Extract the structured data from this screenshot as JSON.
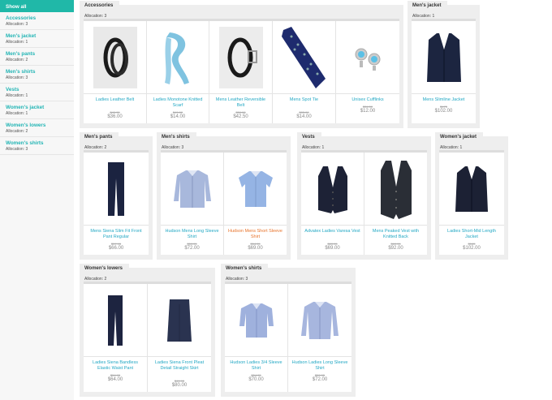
{
  "sidebar": {
    "items": [
      {
        "title": "Show all",
        "sub": ""
      },
      {
        "title": "Accessories",
        "sub": "Allocation: 3"
      },
      {
        "title": "Men's jacket",
        "sub": "Allocation: 1"
      },
      {
        "title": "Men's pants",
        "sub": "Allocation: 2"
      },
      {
        "title": "Men's shirts",
        "sub": "Allocation: 3"
      },
      {
        "title": "Vests",
        "sub": "Allocation: 1"
      },
      {
        "title": "Women's jacket",
        "sub": "Allocation: 1"
      },
      {
        "title": "Women's lowers",
        "sub": "Allocation: 2"
      },
      {
        "title": "Women's shirts",
        "sub": "Allocation: 3"
      }
    ]
  },
  "categories": [
    {
      "name": "Accessories",
      "alloc": "Allocation: 3",
      "items": [
        {
          "name": "Ladies Leather Belt",
          "old": "$49.95",
          "price": "$36.00"
        },
        {
          "name": "Ladies Monotone Knitted Scarf",
          "old": "$49.00",
          "price": "$14.00"
        },
        {
          "name": "Mens Leather Reversible Belt",
          "old": "$59.00",
          "price": "$42.50"
        },
        {
          "name": "Mens Spot Tie",
          "old": "$35.00",
          "price": "$14.00"
        },
        {
          "name": "Unisex Cufflinks",
          "old": "$34.00",
          "price": "$12.00"
        }
      ]
    },
    {
      "name": "Men's jacket",
      "alloc": "Allocation: 1",
      "items": [
        {
          "name": "Mens Slimline Jacket",
          "old": "$175",
          "price": "$102.00"
        }
      ]
    },
    {
      "name": "Men's pants",
      "alloc": "Allocation: 2",
      "items": [
        {
          "name": "Mens Siena Slim Fit Front Pant Regular",
          "old": "$57.95",
          "price": "$66.00"
        }
      ]
    },
    {
      "name": "Men's shirts",
      "alloc": "Allocation: 3",
      "items": [
        {
          "name": "Hudson Mens Long Sleeve Shirt",
          "old": "$59.95",
          "price": "$72.00"
        },
        {
          "name": "Hudson Mens Short Sleeve Shirt",
          "old": "$54.95",
          "price": "$69.00"
        }
      ]
    },
    {
      "name": "Vests",
      "alloc": "Allocation: 1",
      "items": [
        {
          "name": "Advatex Ladies Varesa Vest",
          "old": "$89.95",
          "price": "$69.00"
        },
        {
          "name": "Mens Peaked Vest with Knitted Back",
          "old": "$69.95",
          "price": "$92.00"
        }
      ]
    },
    {
      "name": "Women's jacket",
      "alloc": "Allocation: 1",
      "items": [
        {
          "name": "Ladies Short-Mid Length Jacket",
          "old": "$165",
          "price": "$102.00"
        }
      ]
    },
    {
      "name": "Women's lowers",
      "alloc": "Allocation: 2",
      "items": [
        {
          "name": "Ladies Siena Bandless Elastic Waist Pant",
          "old": "$54.95",
          "price": "$64.00"
        },
        {
          "name": "Ladies Siena Front Pleat Detail Straight Skirt",
          "old": "$49.95",
          "price": "$80.00"
        }
      ]
    },
    {
      "name": "Women's shirts",
      "alloc": "Allocation: 3",
      "items": [
        {
          "name": "Hudson Ladies 3/4 Sleeve Shirt",
          "old": "$54.95",
          "price": "$70.00"
        },
        {
          "name": "Hudson Ladies Long Sleeve Shirt",
          "old": "$59.95",
          "price": "$72.00"
        }
      ]
    }
  ],
  "colors": {
    "accent": "#20b8a8",
    "link": "#23a8c4",
    "highlight_link": "#e8742c"
  }
}
